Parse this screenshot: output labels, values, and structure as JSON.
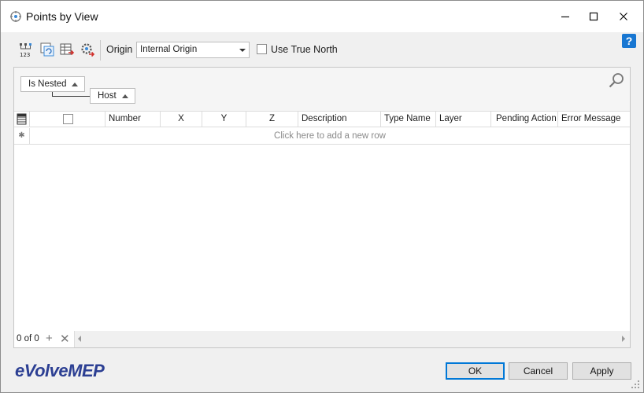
{
  "window": {
    "title": "Points by View",
    "icons": [
      "app-points-icon",
      "minimize-icon",
      "maximize-icon",
      "close-icon"
    ]
  },
  "toolbar": {
    "icons": [
      "point-numbering-icon",
      "refresh-points-icon",
      "export-table-icon",
      "point-settings-icon"
    ],
    "origin_label": "Origin",
    "origin_value": "Internal Origin",
    "true_north_label": "Use True North",
    "true_north_checked": false,
    "help_label": "?"
  },
  "grid": {
    "group_by": [
      "Is Nested",
      "Host"
    ],
    "columns": [
      {
        "key": "select",
        "label": ""
      },
      {
        "key": "number",
        "label": "Number"
      },
      {
        "key": "x",
        "label": "X"
      },
      {
        "key": "y",
        "label": "Y"
      },
      {
        "key": "z",
        "label": "Z"
      },
      {
        "key": "description",
        "label": "Description"
      },
      {
        "key": "type_name",
        "label": "Type Name"
      },
      {
        "key": "layer",
        "label": "Layer"
      },
      {
        "key": "pending_action",
        "label": "Pending Action"
      },
      {
        "key": "error_message",
        "label": "Error Message"
      }
    ],
    "new_row_text": "Click here to add a new row",
    "rows": [],
    "navigator": {
      "record_text": "0 of 0",
      "add_label": "+",
      "delete_label": "✕"
    }
  },
  "footer": {
    "logo_prefix": "e",
    "logo_text": "VolveMEP",
    "ok_label": "OK",
    "cancel_label": "Cancel",
    "apply_label": "Apply"
  },
  "colors": {
    "accent": "#0078d7",
    "help": "#1877d2",
    "logo": "#2c3f93"
  }
}
